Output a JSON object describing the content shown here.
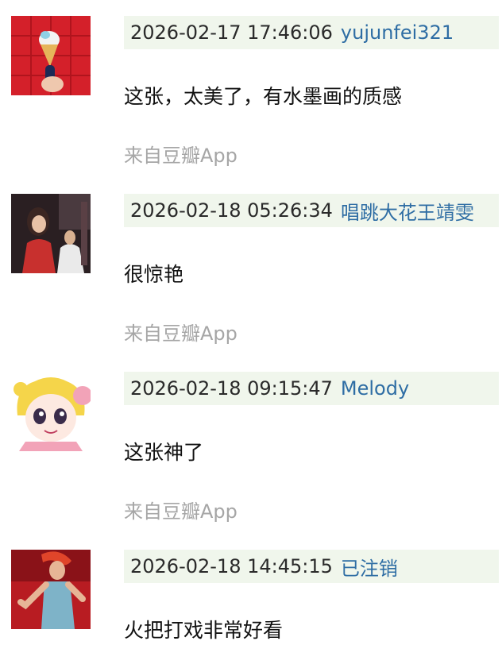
{
  "comments": [
    {
      "timestamp": "2026-02-17 17:46:06",
      "username": "yujunfei321",
      "text": "这张，太美了，有水墨画的质感",
      "source": "来自豆瓣App",
      "avatar": "ice-cream-avatar"
    },
    {
      "timestamp": "2026-02-18 05:26:34",
      "username": "唱跳大花王靖雯",
      "text": "很惊艳",
      "source": "来自豆瓣App",
      "avatar": "photo-avatar"
    },
    {
      "timestamp": "2026-02-18 09:15:47",
      "username": "Melody",
      "text": "这张神了",
      "source": "来自豆瓣App",
      "avatar": "anime-girl-avatar"
    },
    {
      "timestamp": "2026-02-18 14:45:15",
      "username": "已注销",
      "text": "火把打戏非常好看",
      "source": "",
      "avatar": "dancer-avatar"
    }
  ]
}
